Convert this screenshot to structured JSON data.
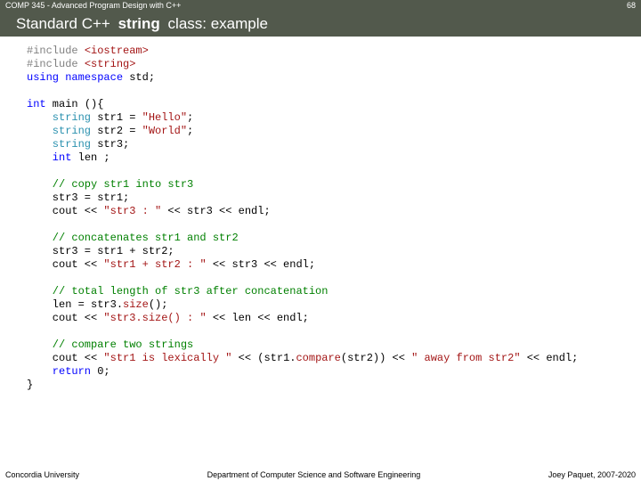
{
  "header": {
    "course": "COMP 345 - Advanced Program Design with C++",
    "slide_number": "68"
  },
  "title": {
    "pre": "Standard C++ ",
    "bold": "string",
    "post": " class: example"
  },
  "code": {
    "l01a": "#include ",
    "l01b": "<iostream>",
    "l02a": "#include ",
    "l02b": "<string>",
    "l03a": "using",
    "l03b": " namespace",
    "l03c": " std;",
    "l05a": "int",
    "l05b": " main (){",
    "l06a": "    string",
    "l06b": " str1 = ",
    "l06c": "\"Hello\"",
    "l06d": ";",
    "l07a": "    string",
    "l07b": " str2 = ",
    "l07c": "\"World\"",
    "l07d": ";",
    "l08a": "    string",
    "l08b": " str3;",
    "l09a": "    int",
    "l09b": " len ;",
    "l11a": "    // copy str1 into str3",
    "l12a": "    str3 = str1;",
    "l13a": "    cout << ",
    "l13b": "\"str3 : \"",
    "l13c": " << str3 << endl;",
    "l15a": "    // concatenates str1 and str2",
    "l16a": "    str3 = str1 + str2;",
    "l17a": "    cout << ",
    "l17b": "\"str1 + str2 : \"",
    "l17c": " << str3 << endl;",
    "l19a": "    // total length of str3 after concatenation",
    "l20a": "    len = str3.",
    "l20b": "size",
    "l20c": "();",
    "l21a": "    cout << ",
    "l21b": "\"str3.size() : \"",
    "l21c": " << len << endl;",
    "l23a": "    // compare two strings",
    "l24a": "    cout << ",
    "l24b": "\"str1 is lexically \"",
    "l24c": " << (str1.",
    "l24d": "compare",
    "l24e": "(str2)) << ",
    "l24f": "\" away from str2\"",
    "l24g": " << endl;",
    "l25a": "    return",
    "l25b": " 0;",
    "l26a": "}"
  },
  "footer": {
    "left": "Concordia University",
    "center": "Department of Computer Science and Software Engineering",
    "right": "Joey Paquet, 2007-2020"
  }
}
